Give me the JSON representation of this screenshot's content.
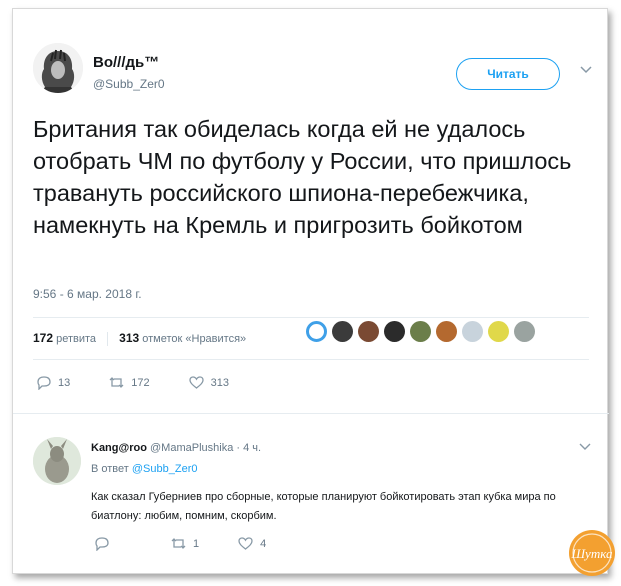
{
  "tweet": {
    "author_name": "Во///дь™",
    "author_handle": "@Subb_Zer0",
    "follow_label": "Читать",
    "text": "Британия так обиделась когда ей не удалось отобрать ЧМ по футболу у России, что пришлось травануть российского шпиона-перебежчика, намекнуть на Кремль и пригрозить бойкотом",
    "timestamp": "9:56 - 6 мар. 2018 г.",
    "retweets_count": "172",
    "retweets_label": "ретвита",
    "likes_count": "313",
    "likes_label": "отметок «Нравится»",
    "actions": {
      "replies": "13",
      "retweets": "172",
      "likes": "313"
    }
  },
  "reply": {
    "author_name": "Kang@roo",
    "author_handle": "@MamaPlushika",
    "time": "· 4 ч.",
    "reply_to_prefix": "В ответ",
    "reply_to_handle": "@Subb_Zer0",
    "text": "Как сказал Губерниев про сборные, которые планируют бойкотировать этап кубка мира по биатлону: любим, помним, скорбим.",
    "actions": {
      "replies": "",
      "retweets": "1",
      "likes": "4"
    }
  },
  "watermark": {
    "text": "Шутка"
  },
  "colors": {
    "accent": "#1da1f2",
    "muted": "#657786",
    "text": "#14171a",
    "logo": "#f3a030"
  }
}
